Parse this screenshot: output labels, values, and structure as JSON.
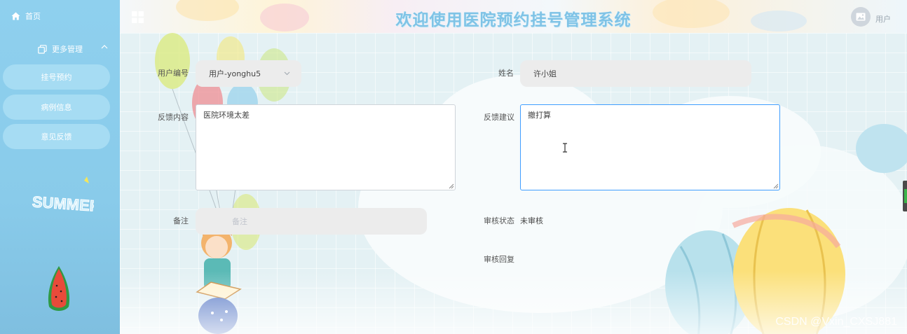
{
  "app": {
    "title": "欢迎使用医院预约挂号管理系统",
    "user_label": "用户"
  },
  "sidebar": {
    "home_label": "首页",
    "group_label": "更多管理",
    "items": [
      {
        "label": "挂号预约"
      },
      {
        "label": "病例信息"
      },
      {
        "label": "意见反馈"
      }
    ],
    "decor_text": "SUMMER"
  },
  "form": {
    "user_id": {
      "label": "用户编号",
      "value": "用户-yonghu5"
    },
    "name": {
      "label": "姓名",
      "value": "许小姐"
    },
    "feedback_content": {
      "label": "反馈内容",
      "value": "医院环境太差"
    },
    "feedback_suggestion": {
      "label": "反馈建议",
      "value": "撤打算"
    },
    "remark": {
      "label": "备注",
      "placeholder": "备注"
    },
    "review_status": {
      "label": "审核状态",
      "value": "未审核"
    },
    "review_reply": {
      "label": "审核回复"
    }
  },
  "watermark": "CSDN @Vxin_CXSJ881",
  "colors": {
    "sidebar_bg": "#8fd0ee",
    "title_color": "#7fc3e6",
    "focus_border": "#409eff"
  }
}
